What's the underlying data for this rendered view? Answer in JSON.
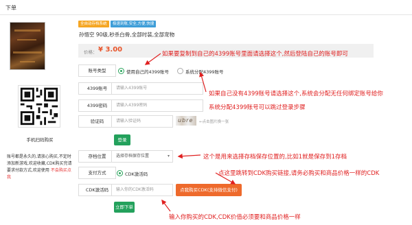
{
  "header": {
    "title": "下单"
  },
  "product": {
    "tags": [
      "全自动存档系统",
      "极速到账,安全,方便,快捷"
    ],
    "title": "孙悟空 90级,秒杀白骨,全部时装,全部宠物",
    "price_label": "价格：",
    "price_value": "¥ 3.00"
  },
  "qr": {
    "label": "手机扫码购买"
  },
  "side_note": {
    "text": "账号都是永久的,请放心购买,不定时添加新游戏,欢迎收藏,CDK购买完请要求付款方式,欢迎使用 ",
    "highlight": "不会购买点我"
  },
  "form": {
    "account_type": {
      "label": "账号类型",
      "options": [
        "使用自己的4399账号",
        "系统分配4399账号"
      ],
      "selected": "使用自己的4399账号"
    },
    "account": {
      "label": "4399账号",
      "placeholder": "请输入4399账号"
    },
    "password": {
      "label": "4399密码",
      "placeholder": "请输入4399密码"
    },
    "captcha": {
      "label": "验证码",
      "placeholder": "请输入验证码",
      "image_text": "ubre",
      "hint": "←点击图片换一张"
    },
    "login_button": "登录",
    "save_slot": {
      "label": "存档位置",
      "selected": "选择存档保存位置"
    },
    "payment": {
      "label": "支付方式",
      "option": "CDK激活码"
    },
    "cdk": {
      "label": "CDK激活码",
      "placeholder": "输入你的CDK激活码",
      "buy_button": "点我购买CDK(支持微信支付)"
    },
    "submit_button": "立即下单"
  },
  "annotations": {
    "a1": "如果要复制到自己的4399账号里面请选择这个,然后登陆自己的账号即可",
    "a2": "如果自己没有4399账号请选择这个,系统会分配无任何绑定账号给你",
    "a3": "系统分配4399账号可以跳过登录步骤",
    "a4": "这个是用来选择存档保存位置的,比如1就是保存到1存档",
    "a5": "点这里跳转到CDK购买链接,请务必购买和商品价格一样的CDK",
    "a6": "输入你购买的CDK,CDK价值必须要和商品价格一样"
  },
  "colors": {
    "annotation": "#e02020",
    "accent_green": "#23a15c",
    "accent_orange": "#ee6a2c",
    "price": "#e8542a"
  }
}
